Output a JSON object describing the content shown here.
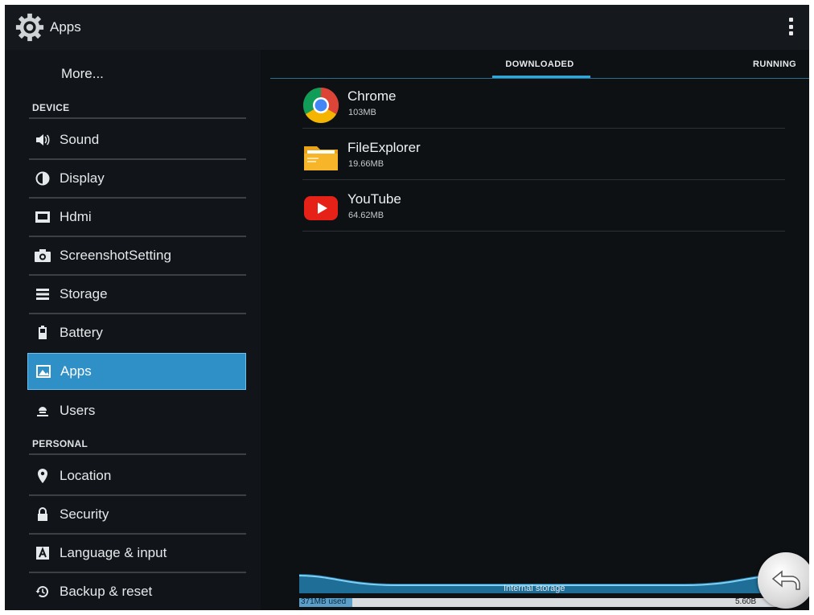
{
  "header": {
    "title": "Apps",
    "icon": "settings-gear-icon",
    "overflow_icon": "overflow-menu-icon"
  },
  "sidebar": {
    "more_label": "More...",
    "device_header": "DEVICE",
    "personal_header": "PERSONAL",
    "device_items": [
      {
        "label": "Sound",
        "icon": "sound-icon"
      },
      {
        "label": "Display",
        "icon": "display-icon"
      },
      {
        "label": "Hdmi",
        "icon": "hdmi-icon"
      },
      {
        "label": "ScreenshotSetting",
        "icon": "camera-icon"
      },
      {
        "label": "Storage",
        "icon": "storage-icon"
      },
      {
        "label": "Battery",
        "icon": "battery-icon"
      },
      {
        "label": "Apps",
        "icon": "apps-icon",
        "selected": true
      },
      {
        "label": "Users",
        "icon": "users-icon"
      }
    ],
    "personal_items": [
      {
        "label": "Location",
        "icon": "location-icon"
      },
      {
        "label": "Security",
        "icon": "lock-icon"
      },
      {
        "label": "Language & input",
        "icon": "language-icon"
      },
      {
        "label": "Backup & reset",
        "icon": "backup-icon"
      }
    ]
  },
  "tabs": {
    "downloaded": "DOWNLOADED",
    "running": "RUNNING",
    "active": "DOWNLOADED",
    "accent_color": "#2fa7d8"
  },
  "apps": [
    {
      "name": "Chrome",
      "size": "103MB",
      "icon": "chrome-icon"
    },
    {
      "name": "FileExplorer",
      "size": "19.66MB",
      "icon": "folder-icon"
    },
    {
      "name": "YouTube",
      "size": "64.62MB",
      "icon": "youtube-icon"
    }
  ],
  "storage": {
    "title": "Internal storage",
    "used": "371MB used",
    "total": "5.60B",
    "used_fraction": 0.065
  },
  "colors": {
    "selected_item": "#2f8fc7",
    "background": "#0e1114"
  }
}
